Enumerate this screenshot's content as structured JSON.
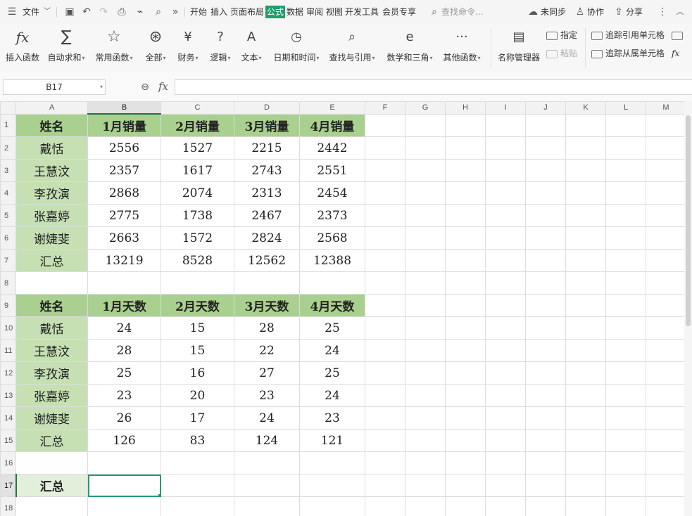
{
  "menubar": {
    "file": "文件",
    "tabs": [
      "开始",
      "插入",
      "页面布局",
      "公式",
      "数据",
      "审阅",
      "视图",
      "开发工具",
      "会员专享"
    ],
    "active_tab_index": 3,
    "search_placeholder": "查找命令...",
    "sync": "未同步",
    "collab": "协作",
    "share": "分享"
  },
  "ribbon": {
    "insert_function": "插入函数",
    "autosum": "自动求和",
    "common": "常用函数",
    "all": "全部",
    "finance": "财务",
    "logic": "逻辑",
    "text": "文本",
    "datetime": "日期和时间",
    "lookup": "查找与引用",
    "math": "数学和三角",
    "other": "其他函数",
    "name_manager": "名称管理器",
    "specify": "指定",
    "paste": "粘贴",
    "trace_precedents": "追踪引用单元格",
    "trace_dependents": "追踪从属单元格"
  },
  "formula_bar": {
    "cell_ref": "B17",
    "formula": ""
  },
  "sheet": {
    "columns": [
      "A",
      "B",
      "C",
      "D",
      "E",
      "F",
      "G",
      "H",
      "I",
      "J",
      "K",
      "L",
      "M"
    ],
    "selected_column": "B",
    "selected_row": 17,
    "rows": [
      [
        "姓名",
        "1月销量",
        "2月销量",
        "3月销量",
        "4月销量"
      ],
      [
        "戴恬",
        "2556",
        "1527",
        "2215",
        "2442"
      ],
      [
        "王慧汶",
        "2357",
        "1617",
        "2743",
        "2551"
      ],
      [
        "李孜演",
        "2868",
        "2074",
        "2313",
        "2454"
      ],
      [
        "张嘉婷",
        "2775",
        "1738",
        "2467",
        "2373"
      ],
      [
        "谢婕斐",
        "2663",
        "1572",
        "2824",
        "2568"
      ],
      [
        "汇总",
        "13219",
        "8528",
        "12562",
        "12388"
      ],
      [
        "",
        "",
        "",
        "",
        ""
      ],
      [
        "姓名",
        "1月天数",
        "2月天数",
        "3月天数",
        "4月天数"
      ],
      [
        "戴恬",
        "24",
        "15",
        "28",
        "25"
      ],
      [
        "王慧汶",
        "28",
        "15",
        "22",
        "24"
      ],
      [
        "李孜演",
        "25",
        "16",
        "27",
        "25"
      ],
      [
        "张嘉婷",
        "23",
        "20",
        "23",
        "24"
      ],
      [
        "谢婕斐",
        "26",
        "17",
        "24",
        "23"
      ],
      [
        "汇总",
        "126",
        "83",
        "124",
        "121"
      ],
      [
        "",
        "",
        "",
        "",
        ""
      ],
      [
        "汇总",
        "",
        "",
        "",
        ""
      ],
      [
        "",
        "",
        "",
        "",
        ""
      ]
    ]
  }
}
